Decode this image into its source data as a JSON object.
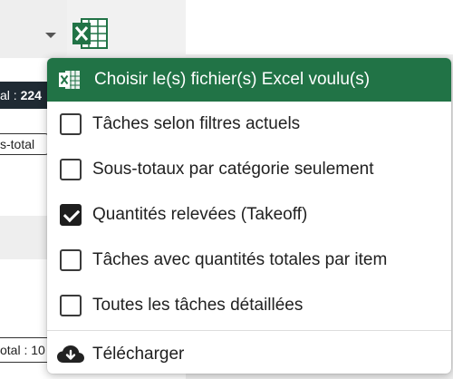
{
  "background": {
    "total_label": "al : ",
    "total_value": "224",
    "subtotal_label": "s-total",
    "bottom_total_label": "otal : 10"
  },
  "menu": {
    "header_label": "Choisir le(s) fichier(s) Excel voulu(s)",
    "header_icon": "excel-icon",
    "items": [
      {
        "label": "Tâches selon filtres actuels",
        "checked": false
      },
      {
        "label": "Sous-totaux par catégorie seulement",
        "checked": false
      },
      {
        "label": "Quantités relevées (Takeoff)",
        "checked": true
      },
      {
        "label": "Tâches avec quantités totales par item",
        "checked": false
      },
      {
        "label": "Toutes les tâches détaillées",
        "checked": false
      }
    ],
    "download_label": "Télécharger",
    "download_icon": "cloud-download-icon"
  },
  "colors": {
    "excel_green": "#217346",
    "checkbox_dark": "#1e1e1e",
    "total_dark_bg": "#1f2a33"
  }
}
